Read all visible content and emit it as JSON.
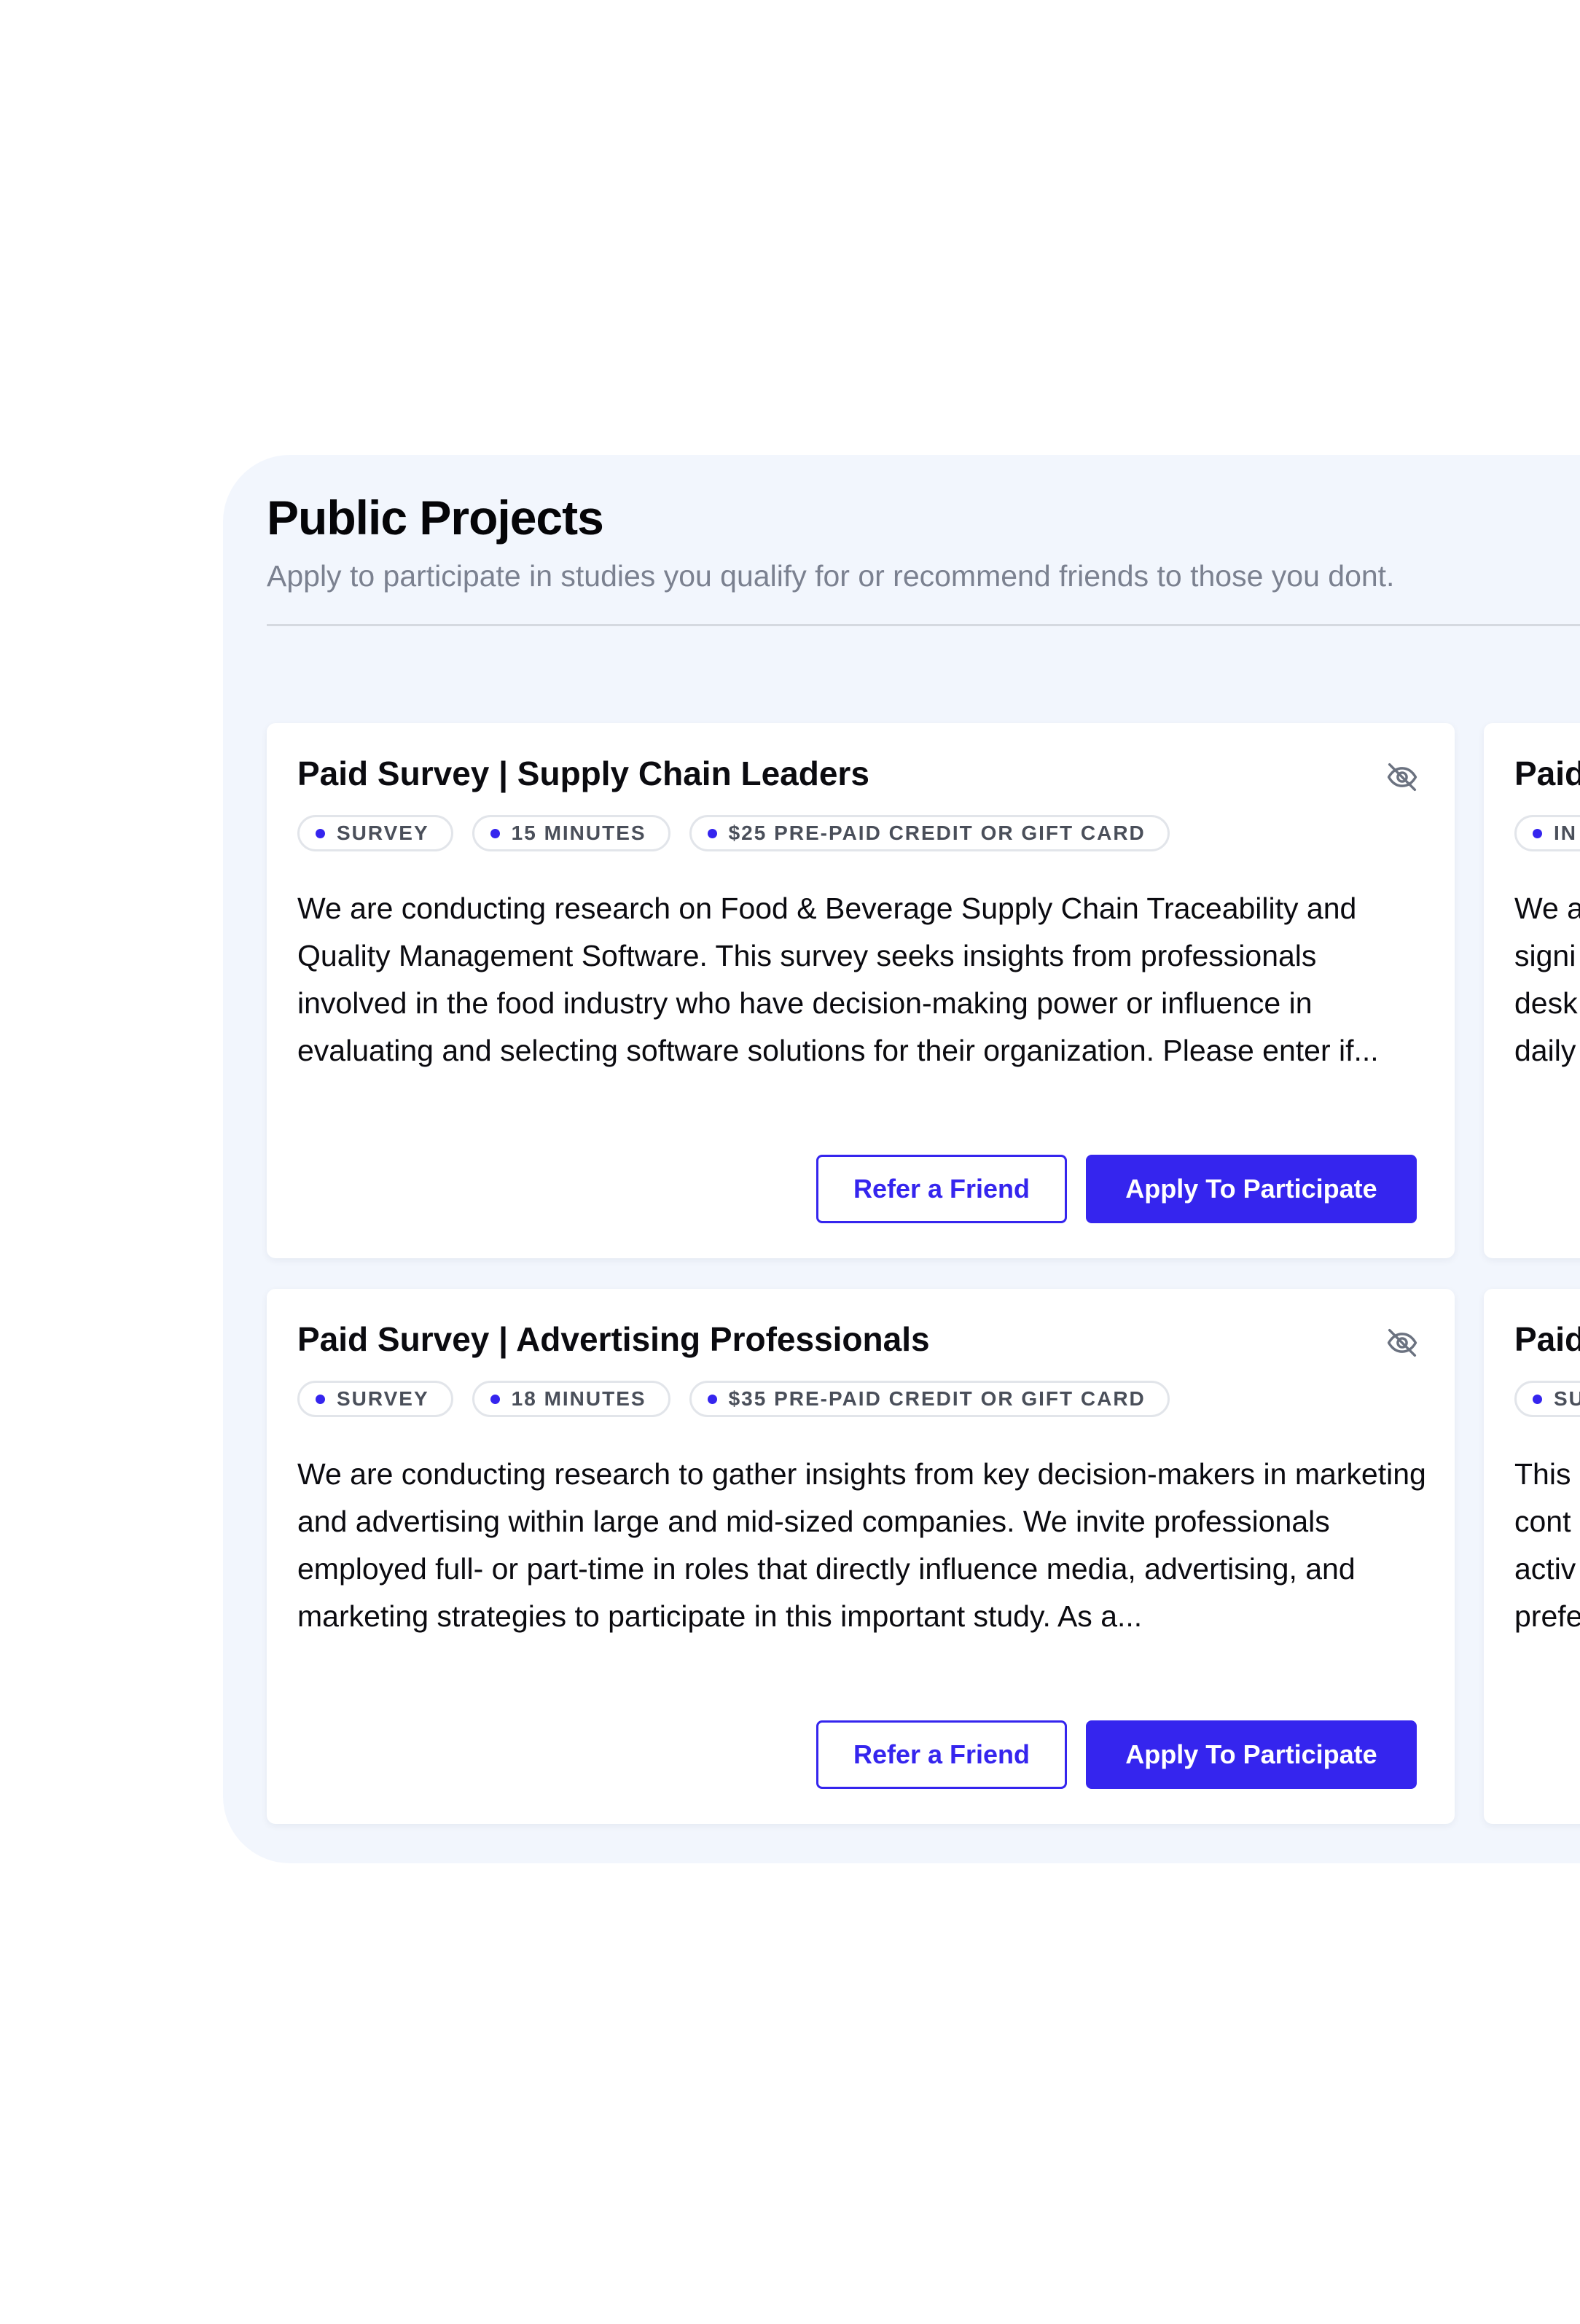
{
  "header": {
    "title": "Public Projects",
    "subtitle": "Apply to participate in studies you qualify for or recommend friends to those you dont."
  },
  "colors": {
    "accent": "#3525ee",
    "panel_background": "#f2f6fd",
    "subtitle_text": "#7b8190"
  },
  "icons": {
    "hide": "eye-slash-icon",
    "tag_bullet": "dot-icon"
  },
  "cards": [
    {
      "title": "Paid Survey | Supply Chain Leaders",
      "tags": [
        "SURVEY",
        "15 MINUTES",
        "$25 PRE-PAID CREDIT OR GIFT CARD"
      ],
      "description": "We are conducting research on Food & Beverage Supply Chain Traceability and Quality Management Software. This survey seeks insights from professionals involved in the food industry who have decision-making power or influence in evaluating and selecting software solutions for their organization. Please enter if...",
      "refer_label": "Refer a Friend",
      "apply_label": "Apply To Participate"
    },
    {
      "title": "Paid Survey | Advertising Professionals",
      "tags": [
        "SURVEY",
        "18 MINUTES",
        "$35 PRE-PAID CREDIT OR GIFT CARD"
      ],
      "description": "We are conducting research to gather insights from key decision-makers in marketing and advertising within large and mid-sized companies. We invite professionals employed full- or part-time in roles that directly influence media, advertising, and marketing strategies to participate in this important study. As a...",
      "refer_label": "Refer a Friend",
      "apply_label": "Apply To Participate"
    },
    {
      "title": "Paid",
      "tags": [
        "IN"
      ],
      "description_lines": [
        "We a",
        "signi",
        "desk",
        "daily"
      ]
    },
    {
      "title": "Paid",
      "tags": [
        "SU"
      ],
      "description_lines": [
        "This",
        "cont",
        "activ",
        "prefe"
      ]
    }
  ]
}
